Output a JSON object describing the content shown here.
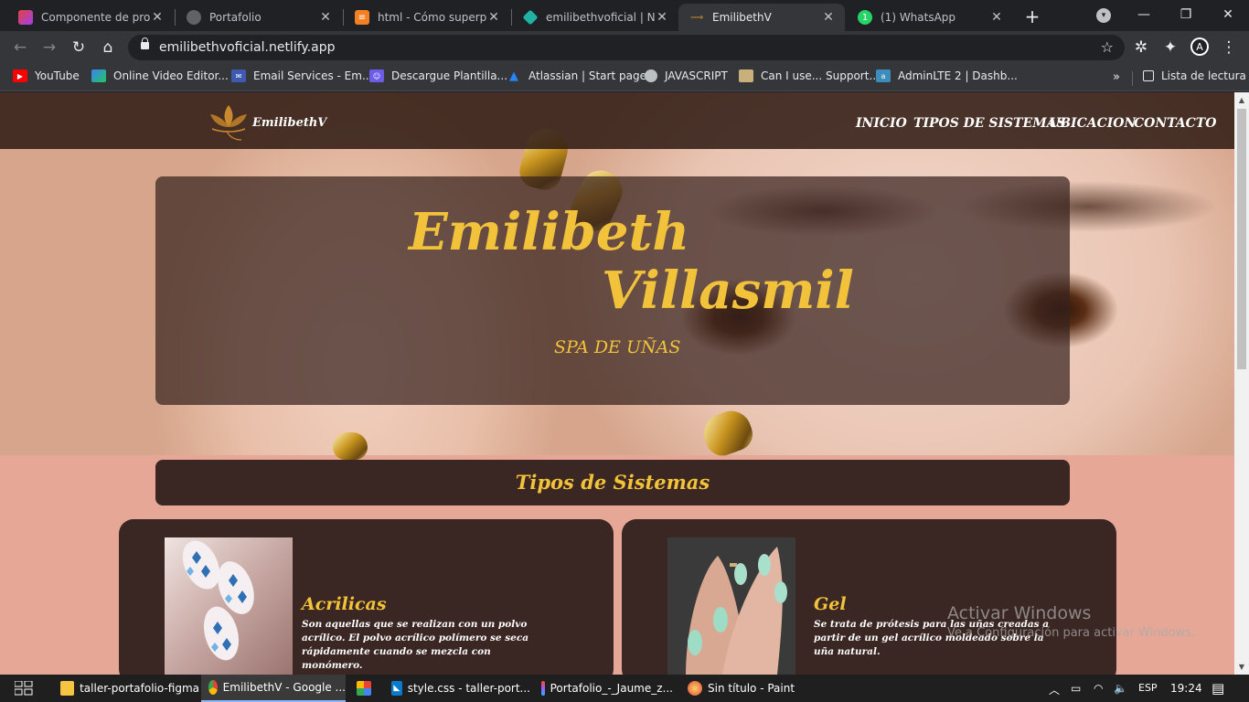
{
  "browser": {
    "tabs": [
      {
        "title": "Componente de proye",
        "icon": "figma-icon"
      },
      {
        "title": "Portafolio",
        "icon": "globe-icon"
      },
      {
        "title": "html - Cómo superpor",
        "icon": "stackoverflow-icon"
      },
      {
        "title": "emilibethvoficial | Netl",
        "icon": "netlify-icon"
      },
      {
        "title": "EmilibethV",
        "icon": "site-icon"
      },
      {
        "title": "(1) WhatsApp",
        "icon": "whatsapp-icon",
        "badge": "1"
      }
    ],
    "active_tab": 4,
    "url": "emilibethvoficial.netlify.app",
    "bookmarks": [
      {
        "label": "YouTube",
        "icon": "youtube-icon"
      },
      {
        "label": "Online Video Editor...",
        "icon": "video-editor-icon"
      },
      {
        "label": "Email Services - Em...",
        "icon": "email-icon"
      },
      {
        "label": "Descargue Plantilla...",
        "icon": "template-icon"
      },
      {
        "label": "Atlassian | Start page",
        "icon": "atlassian-icon"
      },
      {
        "label": "JAVASCRIPT",
        "icon": "globe-icon"
      },
      {
        "label": "Can I use... Support...",
        "icon": "caniuse-icon"
      },
      {
        "label": "AdminLTE 2 | Dashb...",
        "icon": "adminlte-icon"
      }
    ],
    "reading_list": "Lista de lectura",
    "more": "»"
  },
  "site": {
    "logo_text": "EmilibethV",
    "nav": [
      "INICIO",
      "TIPOS DE SISTEMAS",
      "UBICACION",
      "CONTACTO"
    ],
    "hero": {
      "name_line1": "Emilibeth",
      "name_line2": "Villasmil",
      "subtitle": "SPA DE UÑAS"
    },
    "section_title": "Tipos de Sistemas",
    "cards": [
      {
        "title": "Acrilicas",
        "text": "Son aquellas que se realizan con un polvo acrílico. El polvo acrílico polímero se seca rápidamente cuando se mezcla con monómero."
      },
      {
        "title": "Gel",
        "text": "Se trata de prótesis para las uñas creadas a partir de un gel acrílico moldeado sobre la uña natural."
      }
    ],
    "colors": {
      "accent": "#f2c33a",
      "dark": "#3a2622",
      "background": "#e6a797"
    }
  },
  "windows_watermark": {
    "line1": "Activar Windows",
    "line2": "Ve a Configuración para activar Windows."
  },
  "taskbar": {
    "items": [
      {
        "label": "taller-portafolio-figma",
        "icon": "folder-icon"
      },
      {
        "label": "EmilibethV - Google ...",
        "icon": "chrome-icon"
      },
      {
        "label": "",
        "icon": "app-grid-icon"
      },
      {
        "label": "style.css - taller-port...",
        "icon": "vscode-icon"
      },
      {
        "label": "Portafolio_-_Jaume_z...",
        "icon": "figma-icon"
      },
      {
        "label": "Sin título - Paint",
        "icon": "paint-icon"
      }
    ],
    "language": "ESP",
    "time": "19:24"
  }
}
